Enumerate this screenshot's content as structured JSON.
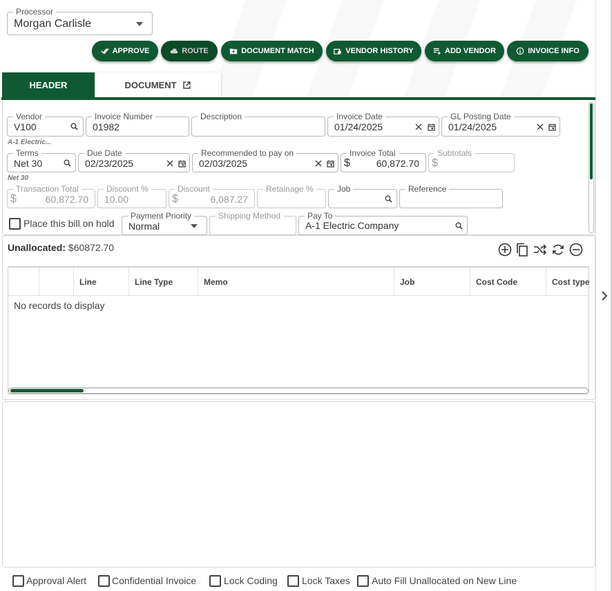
{
  "processor": {
    "label": "Processor",
    "value": "Morgan Carlisle"
  },
  "actions": {
    "approve": "APPROVE",
    "route": "ROUTE",
    "document_match": "DOCUMENT MATCH",
    "vendor_history": "VENDOR HISTORY",
    "add_vendor": "ADD VENDOR",
    "invoice_info": "INVOICE INFO"
  },
  "tabs": {
    "header": "HEADER",
    "document": "DOCUMENT"
  },
  "fields": {
    "vendor": {
      "label": "Vendor",
      "value": "V100",
      "hint": "A-1 Electric..."
    },
    "invoice_number": {
      "label": "Invoice Number",
      "value": "01982"
    },
    "description": {
      "label": "Description",
      "value": ""
    },
    "invoice_date": {
      "label": "Invoice Date",
      "value": "01/24/2025"
    },
    "gl_posting_date": {
      "label": "GL Posting Date",
      "value": "01/24/2025"
    },
    "terms": {
      "label": "Terms",
      "value": "Net 30",
      "hint": "Net 30"
    },
    "due_date": {
      "label": "Due Date",
      "value": "02/23/2025"
    },
    "recommended_pay": {
      "label": "Recommended to pay on",
      "value": "02/03/2025"
    },
    "invoice_total": {
      "label": "Invoice Total",
      "value": "60,872.70",
      "currency": "$"
    },
    "subtotals": {
      "label": "Subtotals",
      "value": "",
      "currency": "$"
    },
    "transaction_total": {
      "label": "Transaction Total",
      "value": "60,872.70",
      "currency": "$"
    },
    "discount_pct": {
      "label": "Discount %",
      "value": "10.00"
    },
    "discount": {
      "label": "Discount",
      "value": "6,087.27",
      "currency": "$"
    },
    "retainage_pct": {
      "label": "Retainage %",
      "value": ""
    },
    "job": {
      "label": "Job",
      "value": ""
    },
    "reference": {
      "label": "Reference",
      "value": ""
    },
    "hold": {
      "label": "Place this bill on hold",
      "checked": false
    },
    "payment_priority": {
      "label": "Payment Priority",
      "value": "Normal"
    },
    "shipping_method": {
      "label": "Shipping Method",
      "value": ""
    },
    "pay_to": {
      "label": "Pay To",
      "value": "A-1 Electric Company"
    }
  },
  "grid": {
    "unallocated_label": "Unallocated:",
    "unallocated_value": "$60872.70",
    "columns": [
      "",
      "",
      "Line",
      "Line Type",
      "Memo",
      "Job",
      "Cost Code",
      "Cost type"
    ],
    "empty": "No records to display",
    "tool_icons": [
      "add-circle-icon",
      "copy-icon",
      "shuffle-icon",
      "refresh-icon",
      "remove-circle-icon"
    ]
  },
  "footer": {
    "approval_alert": "Approval Alert",
    "confidential_invoice": "Confidential Invoice",
    "lock_coding": "Lock Coding",
    "lock_taxes": "Lock Taxes",
    "auto_fill": "Auto Fill Unallocated on New Line"
  },
  "colors": {
    "brand_green": "#0f5a32",
    "border": "#b8b8b8"
  }
}
